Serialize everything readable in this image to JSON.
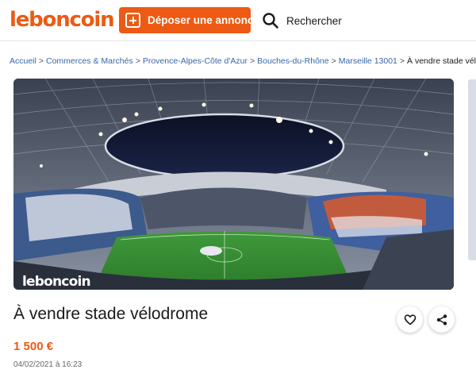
{
  "header": {
    "logo": "leboncoin",
    "post_button_label": "Déposer une annonce",
    "search_label": "Rechercher"
  },
  "breadcrumb": {
    "items": [
      "Accueil",
      "Commerces & Marchés",
      "Provence-Alpes-Côte d'Azur",
      "Bouches-du-Rhône",
      "Marseille 13001"
    ],
    "separator": ">",
    "current": "À vendre stade vélodrome"
  },
  "photo": {
    "watermark": "leboncoin"
  },
  "ad": {
    "title": "À vendre stade vélodrome",
    "price": "1 500 €",
    "date": "04/02/2021 à 16:23"
  },
  "colors": {
    "brand": "#ec5a13",
    "link": "#3767a7"
  },
  "icons": [
    "plus-square-icon",
    "search-icon",
    "heart-icon",
    "share-icon"
  ]
}
